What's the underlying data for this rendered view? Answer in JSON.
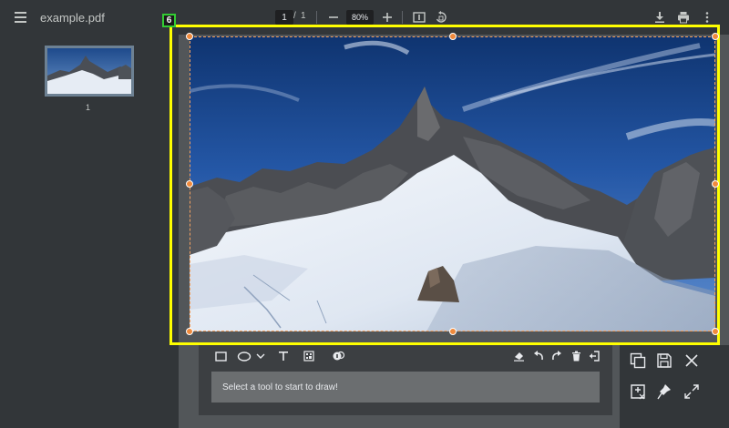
{
  "header": {
    "title": "example.pdf",
    "page_current": "1",
    "page_separator": "/",
    "page_total": "1",
    "zoom_value": "80%"
  },
  "sidebar": {
    "thumbnails": [
      {
        "page_label": "1"
      }
    ]
  },
  "marker": {
    "label": "6"
  },
  "drawing": {
    "hint": "Select a tool to start to draw!",
    "tools": [
      "rectangle-icon",
      "ellipse-icon",
      "chevron-down-icon",
      "text-icon",
      "qr-icon",
      "stamp-icon"
    ],
    "actions": [
      "eraser-icon",
      "undo-icon",
      "redo-icon",
      "trash-icon",
      "exit-icon"
    ]
  },
  "colors": {
    "selection": "#ffff00",
    "handles": "#f08a3c",
    "badge_border": "#33cc33"
  }
}
